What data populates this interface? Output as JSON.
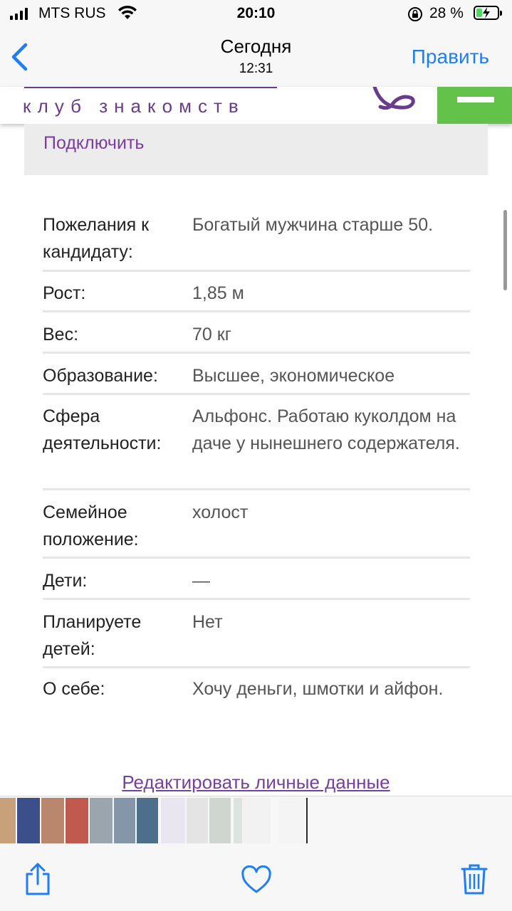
{
  "status_bar": {
    "carrier": "MTS RUS",
    "time": "20:10",
    "battery": "28 %",
    "battery_level": 0.28
  },
  "nav": {
    "title": "Сегодня",
    "subtitle": "12:31",
    "edit_label": "Править"
  },
  "site": {
    "tagline": "клуб знакомств",
    "connect_label": "Подключить"
  },
  "profile": {
    "rows": [
      {
        "label": "Пожелания к кандидату:",
        "value": "Богатый мужчина старше 50."
      },
      {
        "label": "Рост:",
        "value": "1,85 м"
      },
      {
        "label": "Вес:",
        "value": "70 кг"
      },
      {
        "label": "Образование:",
        "value": "Высшее, экономическое"
      },
      {
        "label": "Сфера деятельности:",
        "value": "Альфонс. Работаю куколдом на даче у нынешнего содержателя."
      },
      {
        "label": "Семейное положение:",
        "value": "холост"
      },
      {
        "label": "Дети:",
        "value": "—"
      },
      {
        "label": "Планируете детей:",
        "value": "Нет"
      },
      {
        "label": "О себе:",
        "value": "Хочу деньги, шмотки и айфон."
      }
    ],
    "edit_link": "Редактировать личные данные"
  },
  "thumbnails": [
    {
      "color": "#c8a07a"
    },
    {
      "color": "#3b4f8a"
    },
    {
      "color": "#b9866e"
    },
    {
      "color": "#c05a4e"
    },
    {
      "color": "#9aa5ad"
    },
    {
      "color": "#8596a8"
    },
    {
      "color": "#4d6f8c"
    },
    {
      "color": "#e9e6f0"
    },
    {
      "color": "#e4e4e4"
    },
    {
      "color": "#cfd6cf"
    },
    {
      "color": "#dde4dd"
    },
    {
      "color": "#f2f2f2"
    },
    {
      "color": "#f4f4f4"
    },
    {
      "color": "#2a2a2a"
    }
  ],
  "colors": {
    "accent_link": "#7a3ea0",
    "ios_blue": "#1e7ef7",
    "menu_green": "#63c24a",
    "logo_purple": "#6a3a8f"
  }
}
